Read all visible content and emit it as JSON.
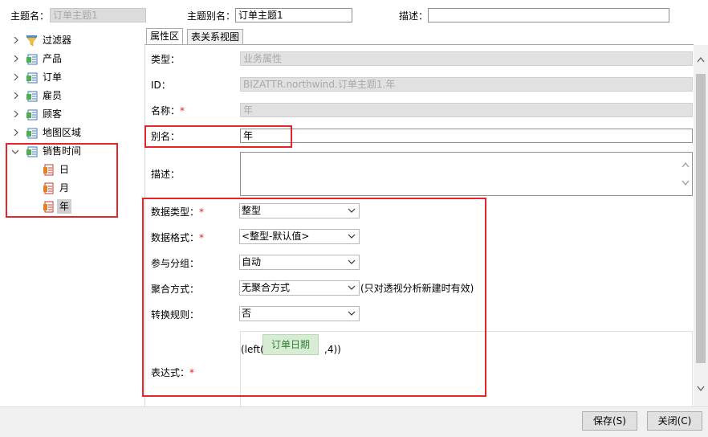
{
  "header": {
    "topic_name_label": "主题名：",
    "topic_name_value": "订单主题1",
    "topic_alias_label": "主题别名：",
    "topic_alias_value": "订单主题1",
    "desc_label": "描述：",
    "desc_value": ""
  },
  "tree": {
    "items": [
      {
        "label": "过滤器",
        "icon": "filter-icon"
      },
      {
        "label": "产品",
        "icon": "table-icon"
      },
      {
        "label": "订单",
        "icon": "table-icon"
      },
      {
        "label": "雇员",
        "icon": "table-icon"
      },
      {
        "label": "顾客",
        "icon": "table-icon"
      },
      {
        "label": "地图区域",
        "icon": "table-icon"
      },
      {
        "label": "销售时间",
        "icon": "table-icon",
        "expanded": true
      }
    ],
    "children": [
      {
        "label": "日",
        "icon": "field-icon"
      },
      {
        "label": "月",
        "icon": "field-icon"
      },
      {
        "label": "年",
        "icon": "field-icon",
        "selected": true
      }
    ]
  },
  "tabs": [
    {
      "label": "属性区",
      "active": true
    },
    {
      "label": "表关系视图",
      "active": false
    }
  ],
  "props": {
    "type_label": "类型：",
    "type_value": "业务属性",
    "id_label": "ID：",
    "id_value": "BIZATTR.northwind.订单主题1.年",
    "name_label": "名称：",
    "name_value": "年",
    "alias_label": "别名：",
    "alias_value": "年",
    "desc_label": "描述：",
    "desc_value": "",
    "datatype_label": "数据类型：",
    "datatype_value": "整型",
    "format_label": "数据格式：",
    "format_value": "<整型-默认值>",
    "group_label": "参与分组：",
    "group_value": "自动",
    "agg_label": "聚合方式：",
    "agg_value": "无聚合方式",
    "agg_note": "(只对透视分析新建时有效)",
    "convert_label": "转换规则：",
    "convert_value": "否",
    "expr_label": "表达式：",
    "expr_prefix": "(left(",
    "expr_token": "订单日期",
    "expr_suffix": ",4))",
    "required_mark": "*"
  },
  "footer": {
    "save_label": "保存(S)",
    "close_label": "关闭(C)"
  },
  "colors": {
    "highlight": "#e8242b",
    "token_bg": "#d8ecd5",
    "token_text": "#2e7d32",
    "disabled_bg": "#e1e1e1"
  }
}
